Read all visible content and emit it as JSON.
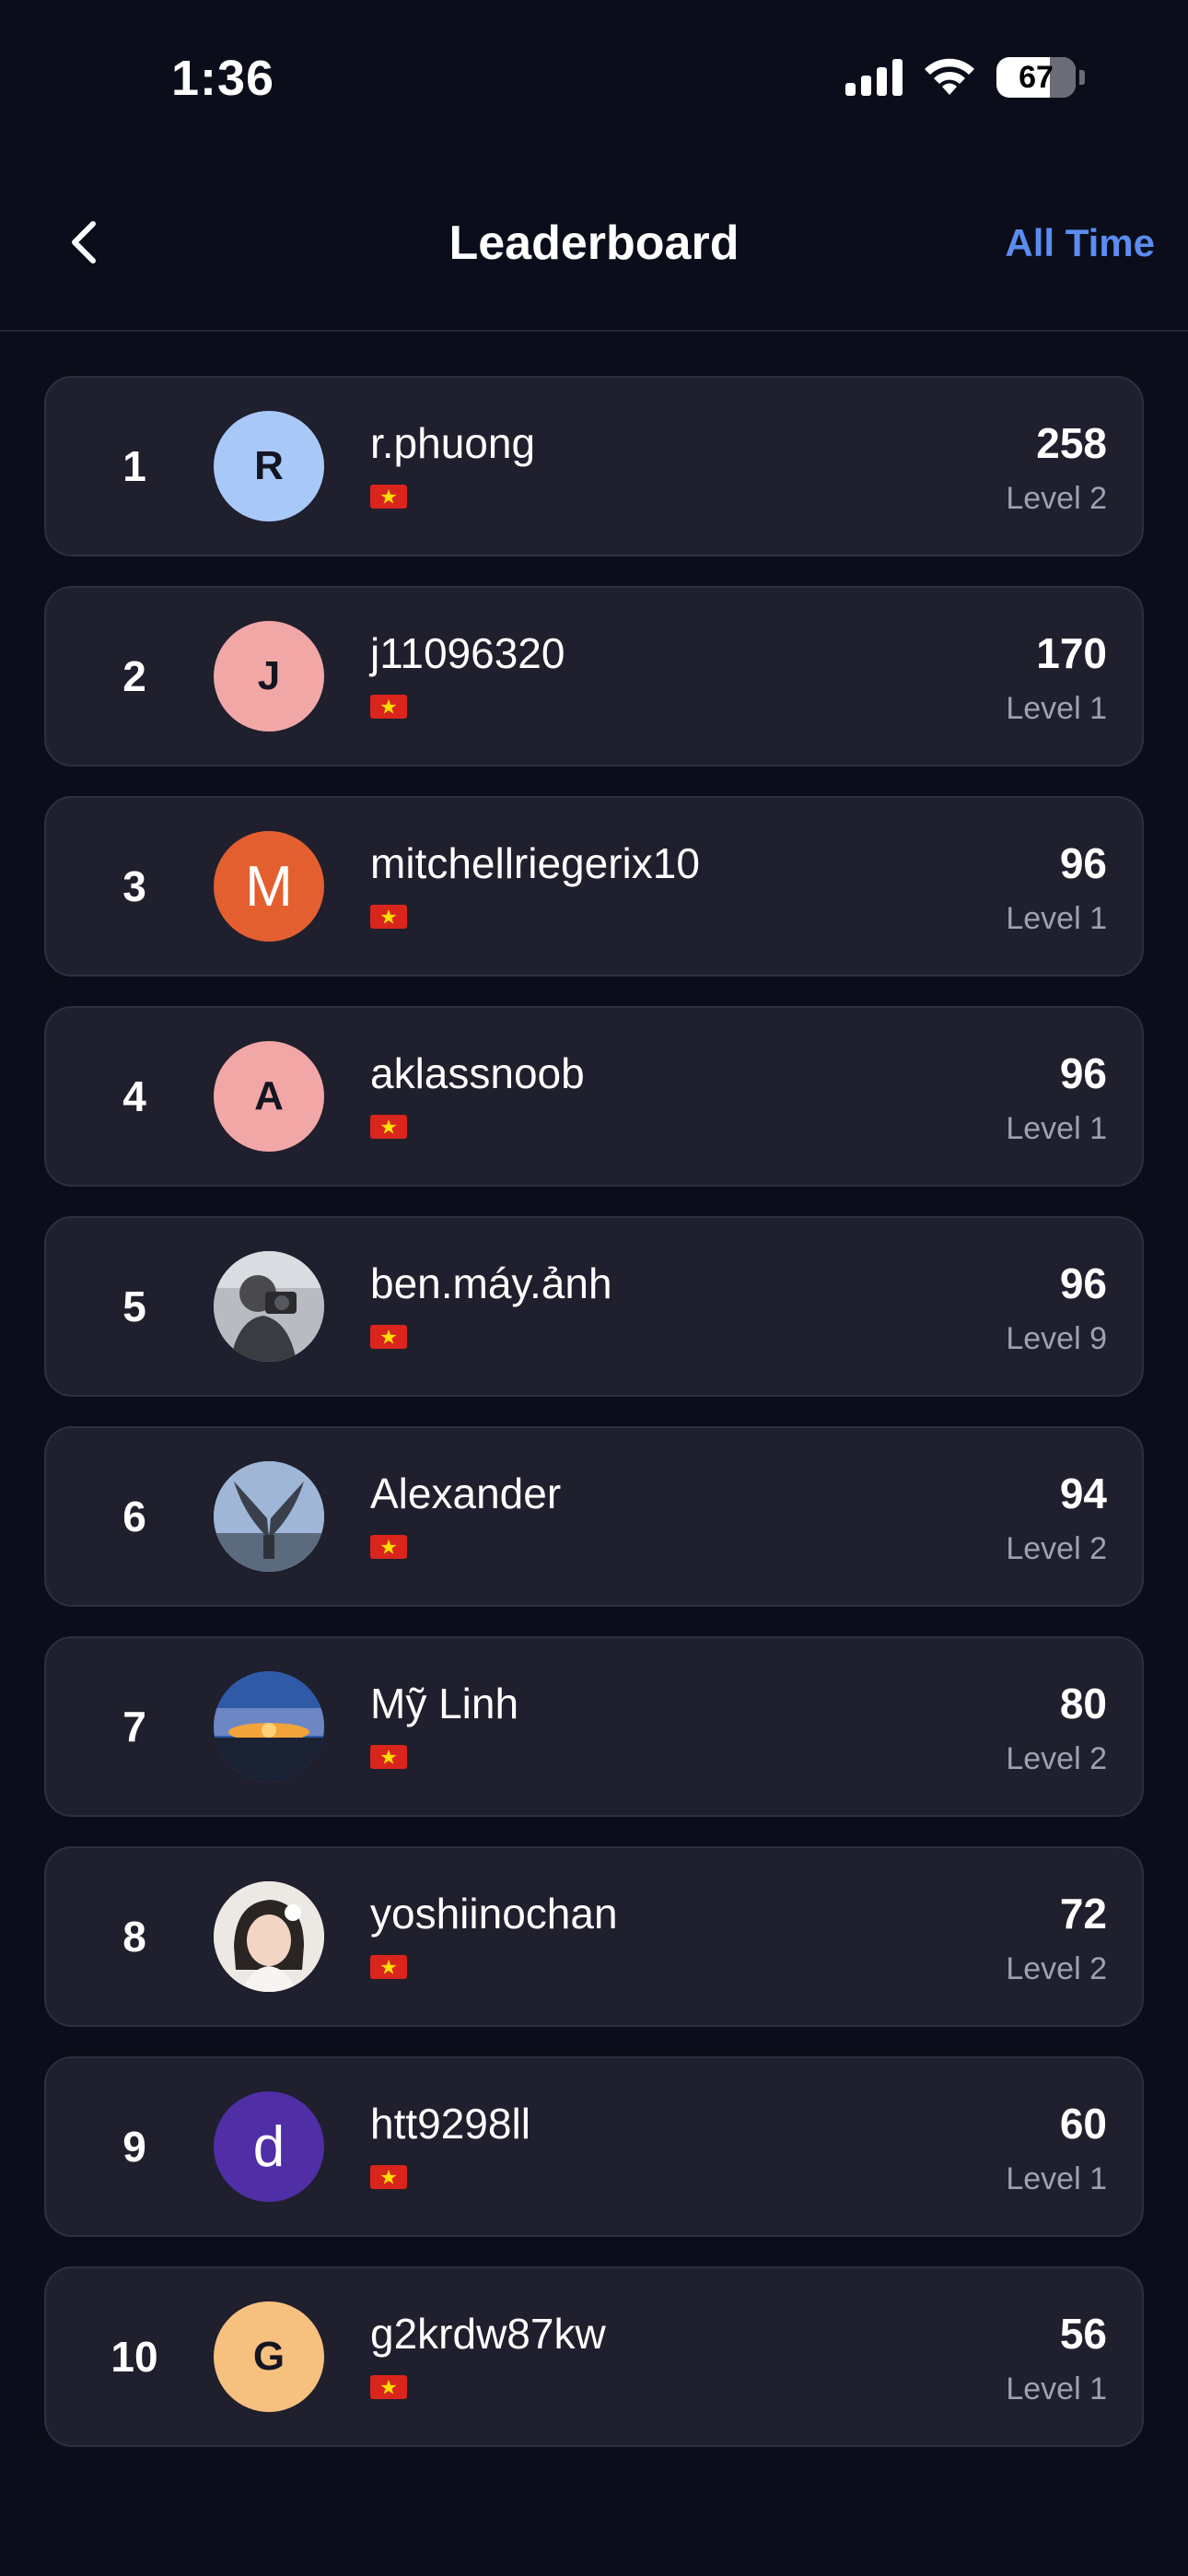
{
  "status_bar": {
    "time": "1:36",
    "battery": "67",
    "icons": [
      "cellular-signal-icon",
      "wifi-icon",
      "battery-icon"
    ]
  },
  "header": {
    "back_icon": "chevron-left-icon",
    "title": "Leaderboard",
    "filter_label": "All Time"
  },
  "colors": {
    "background": "#0b0d1a",
    "card": "#1f1f2d",
    "accent": "#5b8cf0",
    "flag_red": "#da251d",
    "flag_star": "#ffde00"
  },
  "entries": [
    {
      "rank": "1",
      "initial": "R",
      "avatar_color": "#a8c8f8",
      "username": "r.phuong",
      "flag": "vietnam-flag-icon",
      "score": "258",
      "level": "Level 2"
    },
    {
      "rank": "2",
      "initial": "J",
      "avatar_color": "#f2a7a7",
      "username": "j11096320",
      "flag": "vietnam-flag-icon",
      "score": "170",
      "level": "Level 1"
    },
    {
      "rank": "3",
      "initial": "M",
      "avatar_color": "#e45f2f",
      "username": "mitchellriegerix10",
      "flag": "vietnam-flag-icon",
      "score": "96",
      "level": "Level 1"
    },
    {
      "rank": "4",
      "initial": "A",
      "avatar_color": "#f2a7a7",
      "username": "aklassnoob",
      "flag": "vietnam-flag-icon",
      "score": "96",
      "level": "Level 1"
    },
    {
      "rank": "5",
      "avatar": "photo-avatar-photographer",
      "username": "ben.máy.ảnh",
      "flag": "vietnam-flag-icon",
      "score": "96",
      "level": "Level 9"
    },
    {
      "rank": "6",
      "avatar": "photo-avatar-statue",
      "username": "Alexander",
      "flag": "vietnam-flag-icon",
      "score": "94",
      "level": "Level 2"
    },
    {
      "rank": "7",
      "avatar": "photo-avatar-sunset",
      "username": "Mỹ Linh",
      "flag": "vietnam-flag-icon",
      "score": "80",
      "level": "Level 2"
    },
    {
      "rank": "8",
      "avatar": "photo-avatar-portrait",
      "username": "yoshiinochan",
      "flag": "vietnam-flag-icon",
      "score": "72",
      "level": "Level 2"
    },
    {
      "rank": "9",
      "initial": "d",
      "avatar_color": "#4f2ea6",
      "username": "htt9298ll",
      "flag": "vietnam-flag-icon",
      "score": "60",
      "level": "Level 1"
    },
    {
      "rank": "10",
      "initial": "G",
      "avatar_color": "#f6c07f",
      "username": "g2krdw87kw",
      "flag": "vietnam-flag-icon",
      "score": "56",
      "level": "Level 1"
    }
  ]
}
